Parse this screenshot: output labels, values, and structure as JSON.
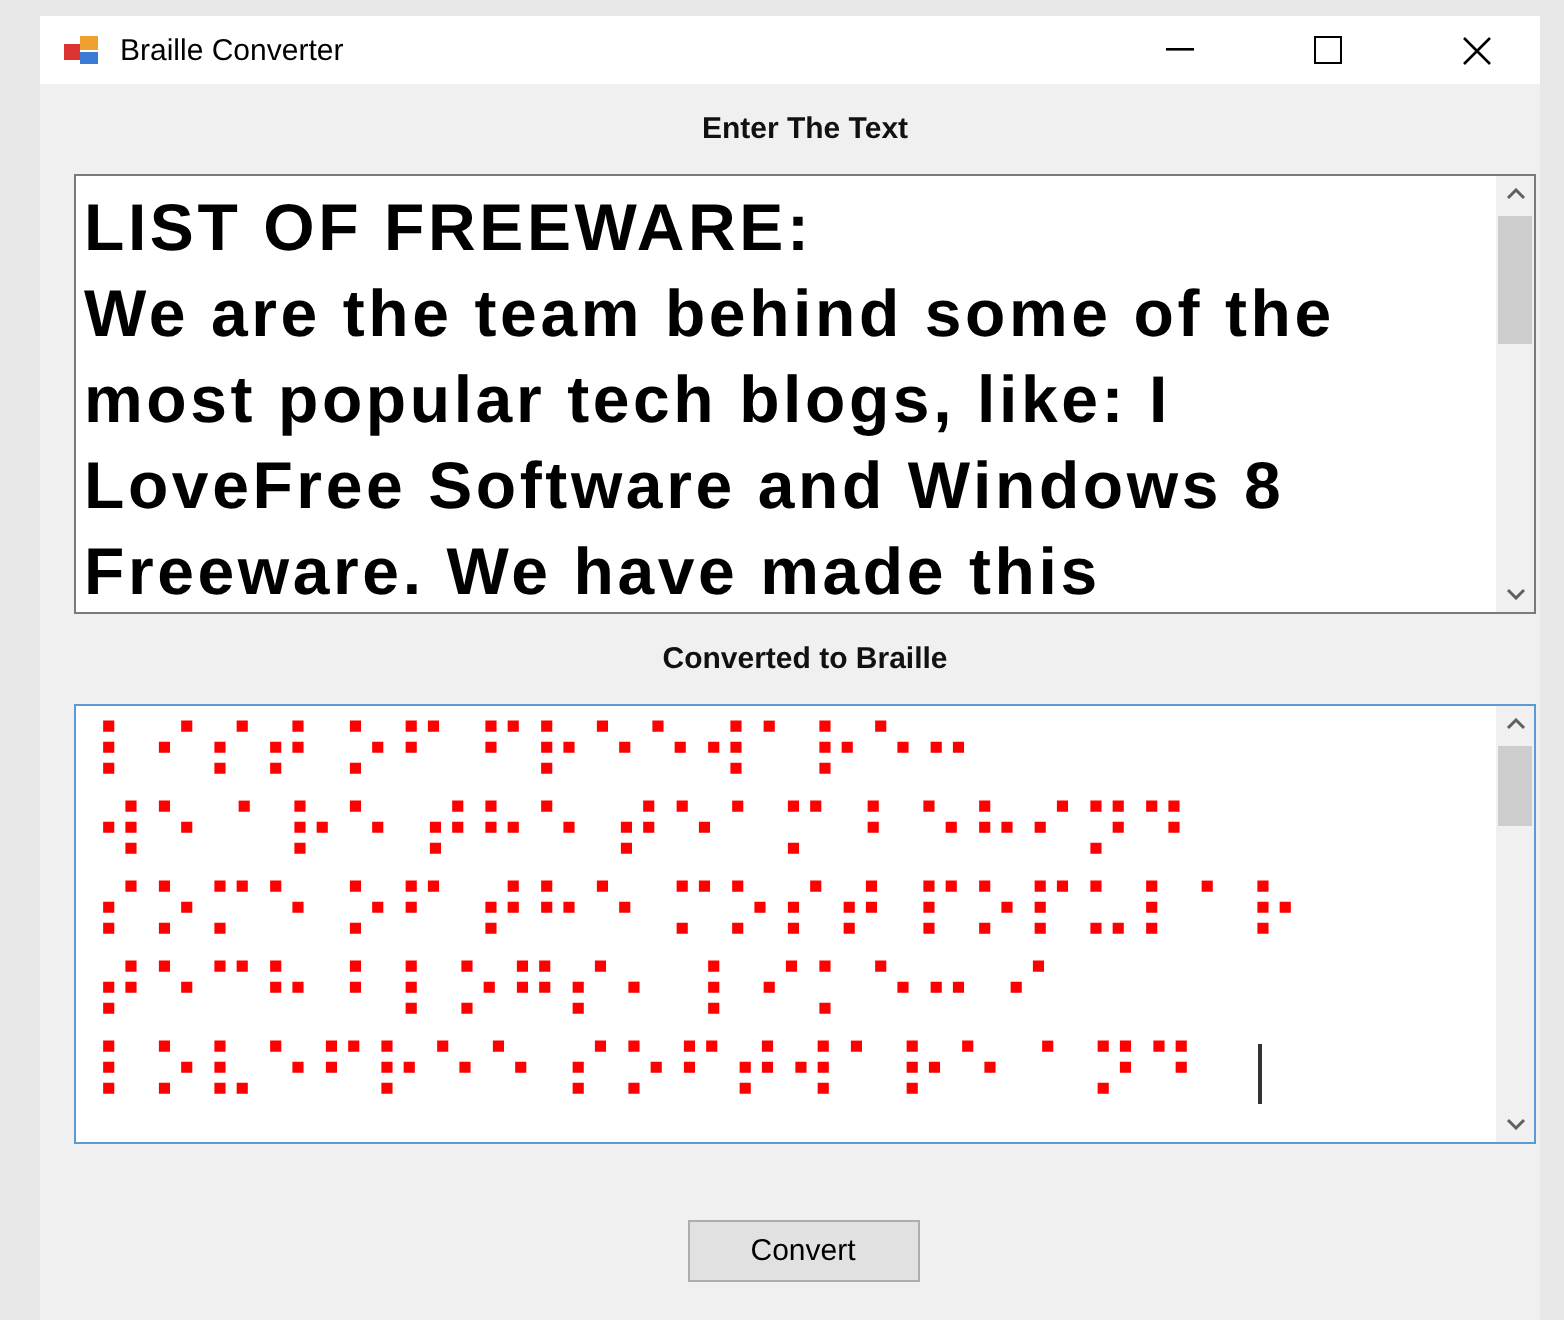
{
  "window": {
    "title": "Braille Converter"
  },
  "input": {
    "label": "Enter The Text",
    "lines": [
      "LIST OF FREEWARE:",
      "We are the team behind some of the",
      "most popular tech blogs, like: I",
      "LoveFree Software and Windows 8",
      "Freeware. We have made this"
    ]
  },
  "output": {
    "label": "Converted to Braille",
    "lines": [
      "⠇⠊⠎⠞ ⠕⠋ ⠋⠗⠑⠑⠺⠁⠗⠑⠒",
      "⠺⠑ ⠁⠗⠑ ⠞⠓⠑ ⠞⠑⠁⠍ ⠃⠑⠓⠊⠝⠙",
      "⠎⠕⠍⠑ ⠕⠋ ⠞⠓⠑ ⠍⠕⠎⠞ ⠏⠕⠏⠥⠇⠁⠗",
      "⠞⠑⠉⠓ ⠃⠇⠕⠛⠎⠂ ⠇⠊⠅⠑⠒ ⠊",
      "⠇⠕⠧⠑⠋⠗⠑⠑ ⠎⠕⠋⠞⠺⠁⠗⠑ ⠁⠝⠙"
    ]
  },
  "buttons": [
    "Convert"
  ]
}
